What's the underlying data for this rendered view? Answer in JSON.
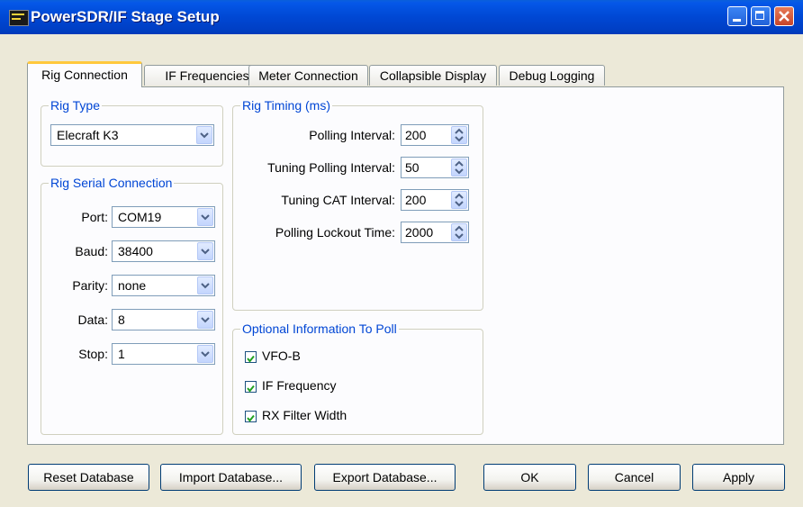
{
  "window": {
    "title": "PowerSDR/IF Stage Setup"
  },
  "tabs": [
    "Rig Connection",
    "IF Frequencies",
    "Meter Connection",
    "Collapsible Display",
    "Debug Logging"
  ],
  "rig_type": {
    "group_label": "Rig Type",
    "value": "Elecraft K3"
  },
  "serial": {
    "group_label": "Rig Serial Connection",
    "port": {
      "label": "Port:",
      "value": "COM19"
    },
    "baud": {
      "label": "Baud:",
      "value": "38400"
    },
    "parity": {
      "label": "Parity:",
      "value": "none"
    },
    "data": {
      "label": "Data:",
      "value": "8"
    },
    "stop": {
      "label": "Stop:",
      "value": "1"
    }
  },
  "timing": {
    "group_label": "Rig Timing (ms)",
    "polling_interval": {
      "label": "Polling Interval:",
      "value": "200"
    },
    "tuning_polling_interval": {
      "label": "Tuning Polling Interval:",
      "value": "50"
    },
    "tuning_cat_interval": {
      "label": "Tuning CAT Interval:",
      "value": "200"
    },
    "polling_lockout_time": {
      "label": "Polling Lockout Time:",
      "value": "2000"
    }
  },
  "optional": {
    "group_label": "Optional Information To Poll",
    "vfo_b": {
      "label": "VFO-B",
      "checked": true
    },
    "if_frequency": {
      "label": "IF Frequency",
      "checked": true
    },
    "rx_filter_width": {
      "label": "RX Filter Width",
      "checked": true
    }
  },
  "buttons": {
    "reset": "Reset Database",
    "import": "Import Database...",
    "export": "Export Database...",
    "ok": "OK",
    "cancel": "Cancel",
    "apply": "Apply"
  }
}
